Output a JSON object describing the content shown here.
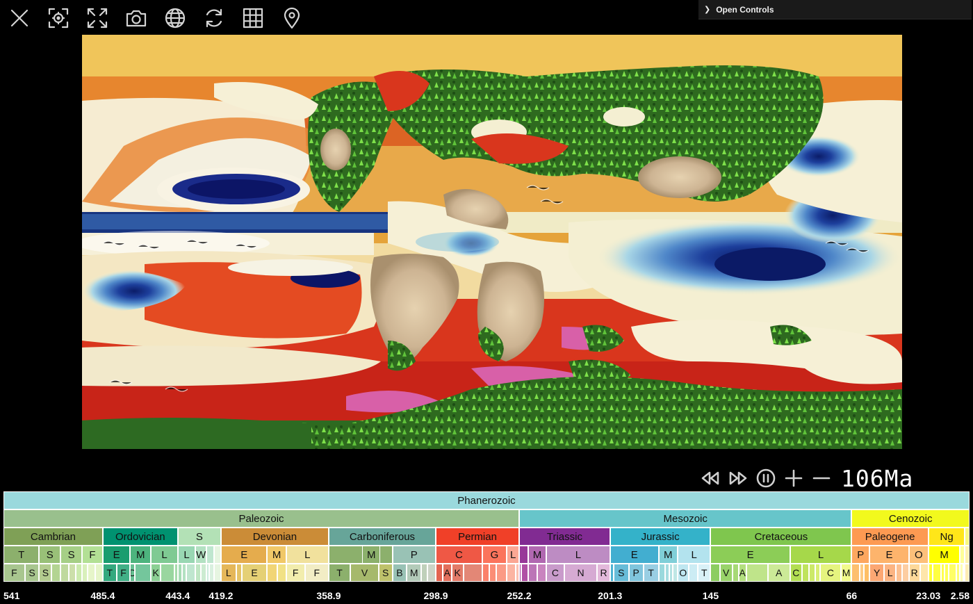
{
  "toolbar": {
    "buttons": [
      {
        "name": "close-icon"
      },
      {
        "name": "focus-icon"
      },
      {
        "name": "fullscreen-icon"
      },
      {
        "name": "camera-icon"
      },
      {
        "name": "globe-icon"
      },
      {
        "name": "refresh-icon"
      },
      {
        "name": "grid-icon"
      },
      {
        "name": "location-pin-icon"
      }
    ]
  },
  "controls": {
    "label": "Open Controls",
    "icon": "chevron-right-icon"
  },
  "playback": {
    "age_label": "106Ma",
    "buttons": [
      "rewind-icon",
      "fast-forward-icon",
      "pause-icon",
      "plus-icon",
      "minus-icon"
    ]
  },
  "colors": {
    "ocean_warm": "#c82418",
    "ocean_cold": "#0a1a6e",
    "land_green": "#2f7a1c",
    "highlight": "#ffffff"
  },
  "timescale": {
    "range": [
      541,
      0
    ],
    "eon": [
      {
        "label": "Phanerozoic",
        "start": 541,
        "end": 0,
        "color": "#9AD9DD"
      }
    ],
    "era": [
      {
        "label": "Paleozoic",
        "start": 541,
        "end": 252.2,
        "color": "#99C08D"
      },
      {
        "label": "Mesozoic",
        "start": 252.2,
        "end": 66,
        "color": "#67C5CA"
      },
      {
        "label": "Cenozoic",
        "start": 66,
        "end": 0,
        "color": "#F2F91D"
      }
    ],
    "period": [
      {
        "label": "Cambrian",
        "start": 541,
        "end": 485.4,
        "color": "#7FA056"
      },
      {
        "label": "Ordovician",
        "start": 485.4,
        "end": 443.4,
        "color": "#009270"
      },
      {
        "label": "S",
        "start": 443.4,
        "end": 419.2,
        "color": "#B3E1B6"
      },
      {
        "label": "Devonian",
        "start": 419.2,
        "end": 358.9,
        "color": "#CB8C37"
      },
      {
        "label": "Carboniferous",
        "start": 358.9,
        "end": 298.9,
        "color": "#67A599"
      },
      {
        "label": "Permian",
        "start": 298.9,
        "end": 252.2,
        "color": "#F04028"
      },
      {
        "label": "Triassic",
        "start": 252.2,
        "end": 201.3,
        "color": "#812B92"
      },
      {
        "label": "Jurassic",
        "start": 201.3,
        "end": 145,
        "color": "#34B2C9"
      },
      {
        "label": "Cretaceous",
        "start": 145,
        "end": 66,
        "color": "#7FC64E"
      },
      {
        "label": "Paleogene",
        "start": 66,
        "end": 23.03,
        "color": "#FD9A52"
      },
      {
        "label": "Ng",
        "start": 23.03,
        "end": 2.58,
        "color": "#FFE619"
      },
      {
        "label": "",
        "start": 2.58,
        "end": 0,
        "color": "#F9F97F"
      }
    ],
    "epoch": [
      {
        "label": "T",
        "start": 541,
        "end": 521,
        "color": "#8CB06C"
      },
      {
        "label": "S",
        "start": 521,
        "end": 509,
        "color": "#99C078"
      },
      {
        "label": "S",
        "start": 509,
        "end": 497,
        "color": "#A6CF86"
      },
      {
        "label": "F",
        "start": 497,
        "end": 485.4,
        "color": "#B3E095"
      },
      {
        "label": "E",
        "start": 485.4,
        "end": 470,
        "color": "#1A9D6F"
      },
      {
        "label": "M",
        "start": 470,
        "end": 458.4,
        "color": "#4DB47E"
      },
      {
        "label": "L",
        "start": 458.4,
        "end": 443.4,
        "color": "#7FCA93"
      },
      {
        "label": "L",
        "start": 443.4,
        "end": 433.4,
        "color": "#99D7B3"
      },
      {
        "label": "W",
        "start": 433.4,
        "end": 427.4,
        "color": "#B3E1C2"
      },
      {
        "label": "",
        "start": 427.4,
        "end": 423,
        "color": "#BFE6CF"
      },
      {
        "label": "",
        "start": 423,
        "end": 419.2,
        "color": "#E6F5E1"
      },
      {
        "label": "E",
        "start": 419.2,
        "end": 393.3,
        "color": "#E5AC4D"
      },
      {
        "label": "M",
        "start": 393.3,
        "end": 382.7,
        "color": "#F1C868"
      },
      {
        "label": "L",
        "start": 382.7,
        "end": 358.9,
        "color": "#F1E19D"
      },
      {
        "label": "",
        "start": 358.9,
        "end": 323.2,
        "color": "#8CB06C"
      },
      {
        "label": "M",
        "start": 340,
        "end": 330,
        "color": "#8CB06C"
      },
      {
        "label": "P",
        "start": 323.2,
        "end": 298.9,
        "color": "#99C2B5"
      },
      {
        "label": "C",
        "start": 298.9,
        "end": 272.95,
        "color": "#EF5845"
      },
      {
        "label": "G",
        "start": 272.95,
        "end": 259.1,
        "color": "#FB745C"
      },
      {
        "label": "L",
        "start": 259.1,
        "end": 252.2,
        "color": "#FBA794"
      },
      {
        "label": "",
        "start": 252.2,
        "end": 247.2,
        "color": "#983999"
      },
      {
        "label": "M",
        "start": 247.2,
        "end": 237,
        "color": "#B168B1"
      },
      {
        "label": "L",
        "start": 237,
        "end": 201.3,
        "color": "#BD8CC3"
      },
      {
        "label": "E",
        "start": 201.3,
        "end": 174.1,
        "color": "#42AED0"
      },
      {
        "label": "M",
        "start": 174.1,
        "end": 163.5,
        "color": "#80CFD8"
      },
      {
        "label": "L",
        "start": 163.5,
        "end": 145,
        "color": "#B3E3EE"
      },
      {
        "label": "E",
        "start": 145,
        "end": 100.5,
        "color": "#8CCD57"
      },
      {
        "label": "L",
        "start": 100.5,
        "end": 66,
        "color": "#A6D84A"
      },
      {
        "label": "P",
        "start": 66,
        "end": 56,
        "color": "#FDA75F"
      },
      {
        "label": "E",
        "start": 56,
        "end": 33.9,
        "color": "#FDB46C"
      },
      {
        "label": "O",
        "start": 33.9,
        "end": 23.03,
        "color": "#FDC07A"
      },
      {
        "label": "M",
        "start": 23.03,
        "end": 5.333,
        "color": "#FFFF00"
      },
      {
        "label": "",
        "start": 5.333,
        "end": 2.58,
        "color": "#FFFF99"
      },
      {
        "label": "",
        "start": 2.58,
        "end": 0,
        "color": "#FFF2AE"
      }
    ],
    "age": [
      {
        "label": "F",
        "start": 541,
        "end": 529,
        "color": "#A8C68F"
      },
      {
        "label": "S",
        "start": 529,
        "end": 521,
        "color": "#A8C68F"
      },
      {
        "label": "S",
        "start": 521,
        "end": 514,
        "color": "#B3CC8F"
      },
      {
        "label": "",
        "start": 514,
        "end": 509,
        "color": "#B3D492"
      },
      {
        "label": "",
        "start": 509,
        "end": 504.5,
        "color": "#BFD99D"
      },
      {
        "label": "",
        "start": 504.5,
        "end": 500.5,
        "color": "#CCDFAA"
      },
      {
        "label": "",
        "start": 500.5,
        "end": 497,
        "color": "#CCEBAE"
      },
      {
        "label": "",
        "start": 497,
        "end": 494,
        "color": "#D9F0BB"
      },
      {
        "label": "",
        "start": 494,
        "end": 489.5,
        "color": "#E6F5C9"
      },
      {
        "label": "",
        "start": 489.5,
        "end": 485.4,
        "color": "#E6F5C9"
      },
      {
        "label": "T",
        "start": 485.4,
        "end": 477.7,
        "color": "#33A97E"
      },
      {
        "label": "F",
        "start": 477.7,
        "end": 470,
        "color": "#41B087"
      },
      {
        "label": "D",
        "start": 470,
        "end": 467.3,
        "color": "#66C092"
      },
      {
        "label": "",
        "start": 467.3,
        "end": 458.4,
        "color": "#74C69C"
      },
      {
        "label": "K",
        "start": 458.4,
        "end": 453,
        "color": "#8CD094"
      },
      {
        "label": "",
        "start": 453,
        "end": 445.2,
        "color": "#99D69F"
      },
      {
        "label": "",
        "start": 445.2,
        "end": 443.4,
        "color": "#A6DBAB"
      },
      {
        "label": "",
        "start": 443.4,
        "end": 440.8,
        "color": "#A6DCB5"
      },
      {
        "label": "",
        "start": 440.8,
        "end": 438.5,
        "color": "#B3E1C2"
      },
      {
        "label": "",
        "start": 438.5,
        "end": 433.4,
        "color": "#BFE6CF"
      },
      {
        "label": "",
        "start": 433.4,
        "end": 430.5,
        "color": "#BFE6C3"
      },
      {
        "label": "",
        "start": 430.5,
        "end": 427.4,
        "color": "#CCEBD1"
      },
      {
        "label": "",
        "start": 427.4,
        "end": 425.6,
        "color": "#CCECDD"
      },
      {
        "label": "",
        "start": 425.6,
        "end": 423,
        "color": "#D9F0DF"
      },
      {
        "label": "",
        "start": 423,
        "end": 419.2,
        "color": "#E6F5E1"
      },
      {
        "label": "L",
        "start": 419.2,
        "end": 410.8,
        "color": "#E5B75A"
      },
      {
        "label": "",
        "start": 410.8,
        "end": 407.6,
        "color": "#E5C468"
      },
      {
        "label": "E",
        "start": 407.6,
        "end": 393.3,
        "color": "#E5D075"
      },
      {
        "label": "",
        "start": 393.3,
        "end": 387.7,
        "color": "#F1D576"
      },
      {
        "label": "",
        "start": 387.7,
        "end": 382.7,
        "color": "#F1E185"
      },
      {
        "label": "F",
        "start": 382.7,
        "end": 372.2,
        "color": "#F2EDAD"
      },
      {
        "label": "F",
        "start": 372.2,
        "end": 358.9,
        "color": "#F2EDC5"
      },
      {
        "label": "T",
        "start": 358.9,
        "end": 346.7,
        "color": "#8CB06C"
      },
      {
        "label": "V",
        "start": 346.7,
        "end": 330.9,
        "color": "#A6B96C"
      },
      {
        "label": "S",
        "start": 330.9,
        "end": 323.2,
        "color": "#BFC26B"
      },
      {
        "label": "B",
        "start": 323.2,
        "end": 315.2,
        "color": "#99C2B5"
      },
      {
        "label": "M",
        "start": 315.2,
        "end": 307,
        "color": "#B3CBB9"
      },
      {
        "label": "",
        "start": 307,
        "end": 303.7,
        "color": "#BFD0BA"
      },
      {
        "label": "",
        "start": 303.7,
        "end": 298.9,
        "color": "#CCD4C7"
      },
      {
        "label": "",
        "start": 298.9,
        "end": 295,
        "color": "#E36350"
      },
      {
        "label": "A",
        "start": 295,
        "end": 290.1,
        "color": "#E36F5C"
      },
      {
        "label": "K",
        "start": 290.1,
        "end": 283.5,
        "color": "#E37B68"
      },
      {
        "label": "",
        "start": 283.5,
        "end": 272.95,
        "color": "#E38776"
      },
      {
        "label": "",
        "start": 272.95,
        "end": 268.8,
        "color": "#FB8069"
      },
      {
        "label": "",
        "start": 268.8,
        "end": 265.1,
        "color": "#FB8D76"
      },
      {
        "label": "",
        "start": 265.1,
        "end": 259.1,
        "color": "#FB9A85"
      },
      {
        "label": "",
        "start": 259.1,
        "end": 254.14,
        "color": "#FCB4A2"
      },
      {
        "label": "",
        "start": 254.14,
        "end": 252.2,
        "color": "#FCC0B2"
      },
      {
        "label": "",
        "start": 252.2,
        "end": 251.2,
        "color": "#A4469F"
      },
      {
        "label": "",
        "start": 251.2,
        "end": 247.2,
        "color": "#B051A5"
      },
      {
        "label": "",
        "start": 247.2,
        "end": 242,
        "color": "#BC75B7"
      },
      {
        "label": "",
        "start": 242,
        "end": 237,
        "color": "#C983BF"
      },
      {
        "label": "C",
        "start": 237,
        "end": 227,
        "color": "#C99BCB"
      },
      {
        "label": "N",
        "start": 227,
        "end": 208.5,
        "color": "#D6AAD3"
      },
      {
        "label": "R",
        "start": 208.5,
        "end": 201.3,
        "color": "#E3B9DB"
      },
      {
        "label": "",
        "start": 201.3,
        "end": 199.3,
        "color": "#4EB3D3"
      },
      {
        "label": "S",
        "start": 199.3,
        "end": 190.8,
        "color": "#67BCD8"
      },
      {
        "label": "P",
        "start": 190.8,
        "end": 182.7,
        "color": "#80C5DD"
      },
      {
        "label": "T",
        "start": 182.7,
        "end": 174.1,
        "color": "#99CEE3"
      },
      {
        "label": "",
        "start": 174.1,
        "end": 170.3,
        "color": "#9AD9DD"
      },
      {
        "label": "",
        "start": 170.3,
        "end": 168.3,
        "color": "#A6DDE0"
      },
      {
        "label": "",
        "start": 168.3,
        "end": 166.1,
        "color": "#B3E2E3"
      },
      {
        "label": "",
        "start": 166.1,
        "end": 163.5,
        "color": "#BFE7E5"
      },
      {
        "label": "O",
        "start": 163.5,
        "end": 157.3,
        "color": "#BFE7F1"
      },
      {
        "label": "",
        "start": 157.3,
        "end": 152.1,
        "color": "#CCECF4"
      },
      {
        "label": "T",
        "start": 152.1,
        "end": 145,
        "color": "#D9F1F7"
      },
      {
        "label": "",
        "start": 145,
        "end": 139.8,
        "color": "#8CCD60"
      },
      {
        "label": "V",
        "start": 139.8,
        "end": 132.9,
        "color": "#99D36A"
      },
      {
        "label": "",
        "start": 132.9,
        "end": 129.4,
        "color": "#A6D975"
      },
      {
        "label": "A",
        "start": 129.4,
        "end": 125,
        "color": "#B3DF7F"
      },
      {
        "label": "",
        "start": 125,
        "end": 113,
        "color": "#BFE48A"
      },
      {
        "label": "A",
        "start": 113,
        "end": 100.5,
        "color": "#CCEA97"
      },
      {
        "label": "C",
        "start": 100.5,
        "end": 93.9,
        "color": "#B3DE53"
      },
      {
        "label": "",
        "start": 93.9,
        "end": 89.8,
        "color": "#BFE35D"
      },
      {
        "label": "",
        "start": 89.8,
        "end": 86.3,
        "color": "#CCE968"
      },
      {
        "label": "",
        "start": 86.3,
        "end": 83.6,
        "color": "#D9EF74"
      },
      {
        "label": "C",
        "start": 83.6,
        "end": 72.1,
        "color": "#E6F47F"
      },
      {
        "label": "M",
        "start": 72.1,
        "end": 66,
        "color": "#F2FA8C"
      },
      {
        "label": "",
        "start": 66,
        "end": 61.6,
        "color": "#FDBF6F"
      },
      {
        "label": "",
        "start": 61.6,
        "end": 59.2,
        "color": "#FECC84"
      },
      {
        "label": "",
        "start": 59.2,
        "end": 56,
        "color": "#FEBF65"
      },
      {
        "label": "Y",
        "start": 56,
        "end": 47.8,
        "color": "#FCA773"
      },
      {
        "label": "L",
        "start": 47.8,
        "end": 41.2,
        "color": "#FCB482"
      },
      {
        "label": "",
        "start": 41.2,
        "end": 37.8,
        "color": "#FDC091"
      },
      {
        "label": "",
        "start": 37.8,
        "end": 33.9,
        "color": "#FDCDA1"
      },
      {
        "label": "R",
        "start": 33.9,
        "end": 27.82,
        "color": "#FED99A"
      },
      {
        "label": "",
        "start": 27.82,
        "end": 23.03,
        "color": "#FEE6AA"
      },
      {
        "label": "",
        "start": 23.03,
        "end": 20.44,
        "color": "#FFFF33"
      },
      {
        "label": "",
        "start": 20.44,
        "end": 15.97,
        "color": "#FFFF41"
      },
      {
        "label": "",
        "start": 15.97,
        "end": 13.82,
        "color": "#FFFF4D"
      },
      {
        "label": "",
        "start": 13.82,
        "end": 11.63,
        "color": "#FFFF59"
      },
      {
        "label": "",
        "start": 11.63,
        "end": 7.246,
        "color": "#FFFF66"
      },
      {
        "label": "",
        "start": 7.246,
        "end": 5.333,
        "color": "#FFFF73"
      },
      {
        "label": "",
        "start": 5.333,
        "end": 3.6,
        "color": "#FFFFB3"
      },
      {
        "label": "",
        "start": 3.6,
        "end": 2.58,
        "color": "#FFFFBF"
      },
      {
        "label": "",
        "start": 2.58,
        "end": 0,
        "color": "#FFEDB3"
      }
    ],
    "ticks": [
      "541",
      "485.4",
      "443.4",
      "419.2",
      "358.9",
      "298.9",
      "252.2",
      "201.3",
      "145",
      "66",
      "23.03",
      "2.58"
    ]
  }
}
